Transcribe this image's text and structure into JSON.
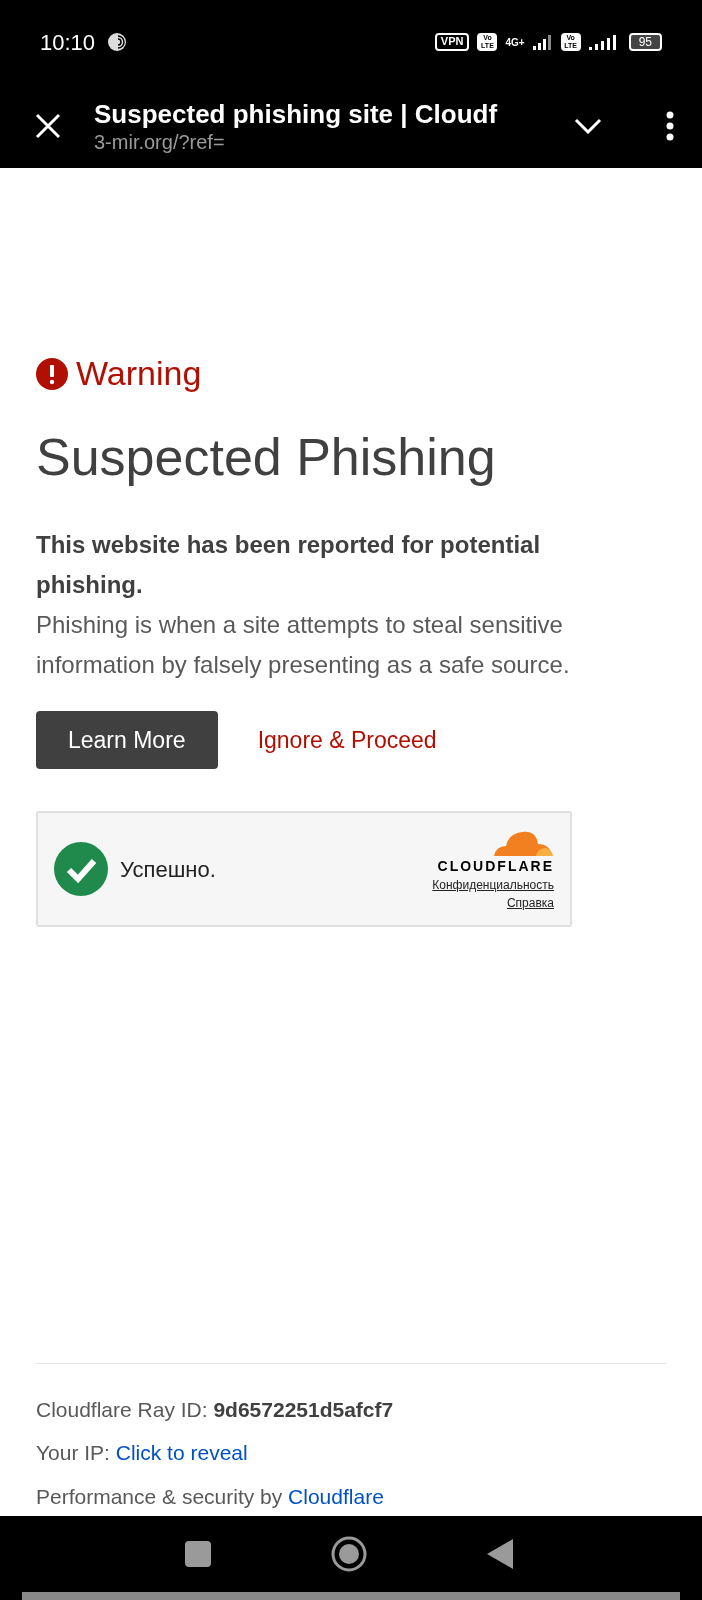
{
  "status_bar": {
    "time": "10:10",
    "vpn": "VPN",
    "volte_1": "Vo LTE",
    "network": "4G+",
    "volte_2": "Vo LTE",
    "battery": "95"
  },
  "top_bar": {
    "title": "Suspected phishing site | Cloudf",
    "url": "3-mir.org/?ref="
  },
  "warning": {
    "label": "Warning",
    "heading": "Suspected Phishing",
    "lead": "This website has been reported for potential phishing.",
    "body": "Phishing is when a site attempts to steal sensitive information by falsely presenting as a safe source."
  },
  "buttons": [
    {
      "kind": "filled",
      "label": "Learn More"
    },
    {
      "kind": "link",
      "label": "Ignore & Proceed"
    }
  ],
  "challenge": {
    "status": "Успешно.",
    "brand": "CLOUDFLARE",
    "links": [
      "Конфиденциальность",
      "Справка"
    ]
  },
  "footer": {
    "ray_label": "Cloudflare Ray ID: ",
    "ray_id": "9d6572251d5afcf7",
    "ip_label": "Your IP: ",
    "ip_link": "Click to reveal",
    "perf_label": "Performance & security by ",
    "perf_link": "Cloudflare"
  }
}
